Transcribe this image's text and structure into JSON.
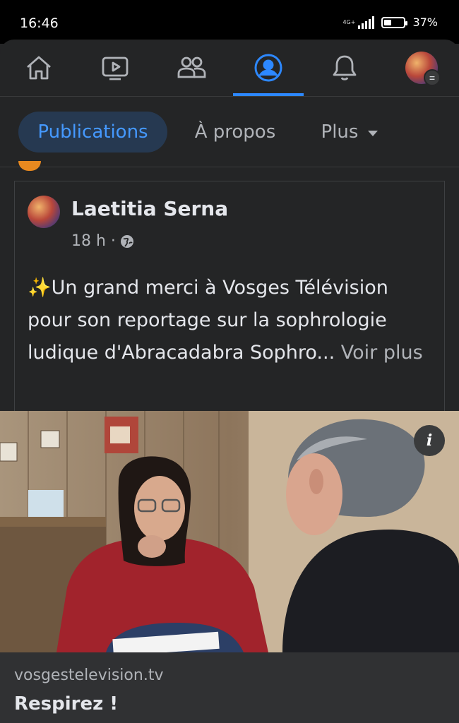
{
  "status": {
    "time": "16:46",
    "network": "4G+",
    "battery": "37%",
    "battery_level": 0.37
  },
  "nav": {
    "items": [
      {
        "name": "home"
      },
      {
        "name": "watch"
      },
      {
        "name": "groups"
      },
      {
        "name": "profile",
        "active": true
      },
      {
        "name": "notifications"
      },
      {
        "name": "menu"
      }
    ],
    "accent": "#2d88ff"
  },
  "tabs": {
    "publications": "Publications",
    "about": "À propos",
    "more": "Plus"
  },
  "post": {
    "author": "Laetitia Serna",
    "time": "18 h ·",
    "text": "✨Un grand merci à Vosges Télévision pour son reportage sur la sophrologie ludique d'Abracadabra Sophro...",
    "see_more": "Voir plus",
    "info_icon": "i"
  },
  "link": {
    "domain": "vosgestelevision.tv",
    "title": "Respirez !"
  }
}
